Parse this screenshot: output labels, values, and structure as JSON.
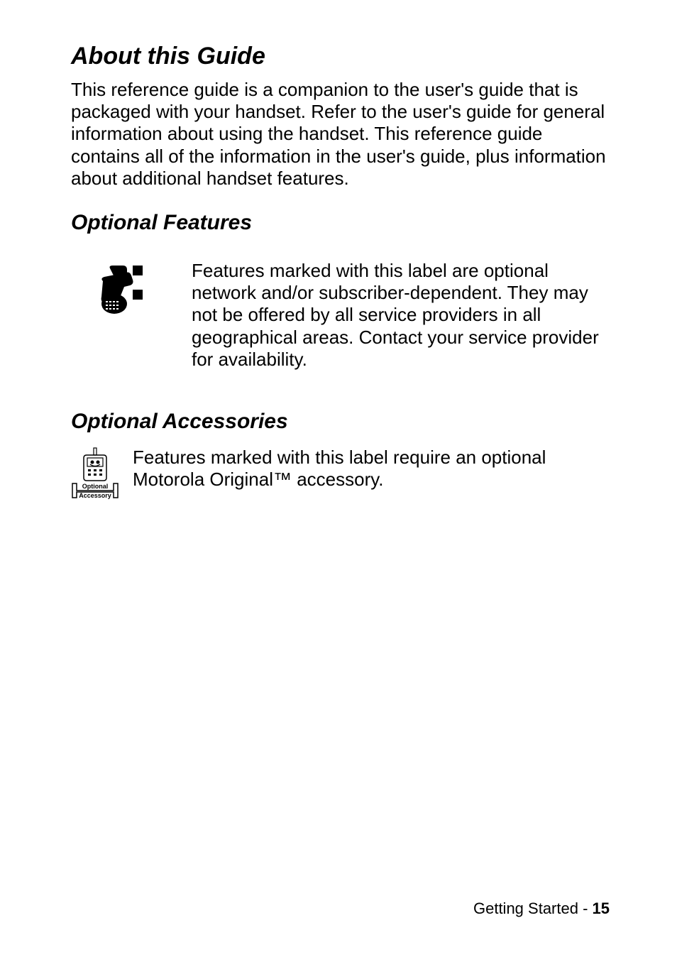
{
  "sections": {
    "about": {
      "heading": "About this Guide",
      "body": "This reference guide is a companion to the user's guide that is packaged with your handset. Refer to the user's guide for general information about using the handset. This reference guide contains all of the information in the user's guide, plus information about additional handset features."
    },
    "optional_features": {
      "heading": "Optional Features",
      "body": "Features marked with this label are optional network and/or subscriber-dependent. They may not be offered by all service providers in all geographical areas. Contact your service provider for availability."
    },
    "optional_accessories": {
      "heading": "Optional Accessories",
      "body": "Features marked with this label require an optional Motorola Original™ accessory.",
      "icon_label_line1": "Optional",
      "icon_label_line2": "Accessory"
    }
  },
  "footer": {
    "section_name": "Getting Started - ",
    "page_number": "15"
  }
}
